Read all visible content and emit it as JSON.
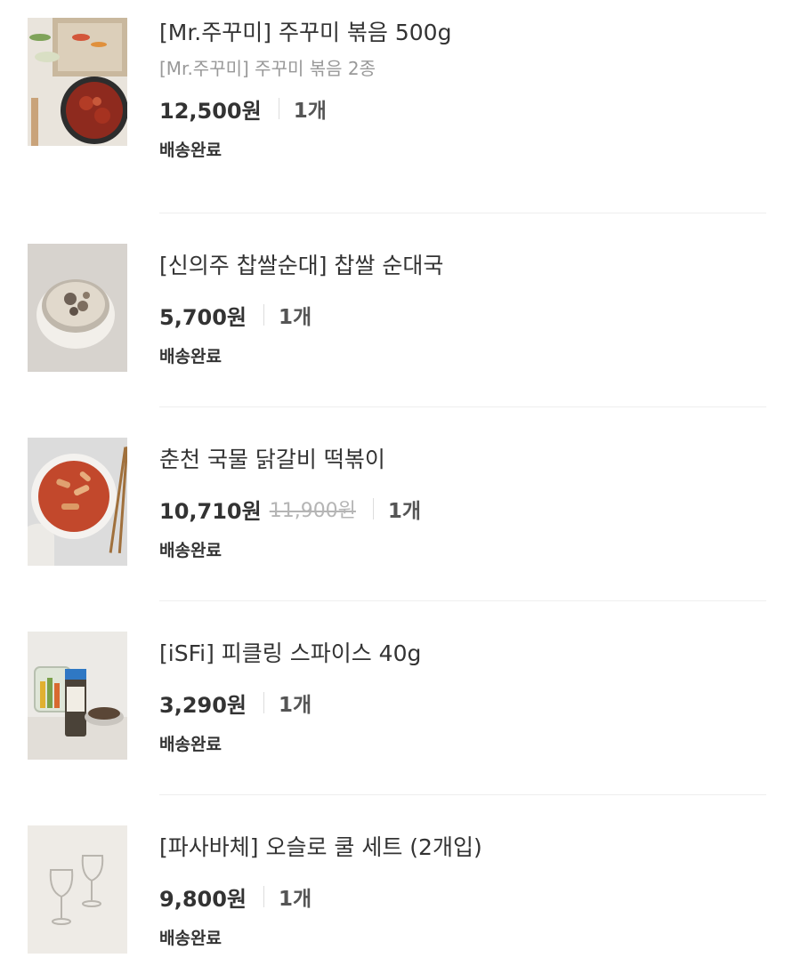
{
  "orders": [
    {
      "name": "[Mr.주꾸미] 주꾸미 볶음 500g",
      "option": "[Mr.주꾸미] 주꾸미 볶음 2종",
      "price": "12,500원",
      "original_price": null,
      "quantity": "1개",
      "status": "배송완료",
      "image": "stir-fried-webfoot-octopus-photo"
    },
    {
      "name": "[신의주 찹쌀순대] 찹쌀 순대국",
      "option": null,
      "price": "5,700원",
      "original_price": null,
      "quantity": "1개",
      "status": "배송완료",
      "image": "sundae-soup-bowl-photo"
    },
    {
      "name": "춘천 국물 닭갈비 떡볶이",
      "option": null,
      "price": "10,710원",
      "original_price": "11,900원",
      "quantity": "1개",
      "status": "배송완료",
      "image": "tteokbokki-plate-photo"
    },
    {
      "name": "[iSFi] 피클링 스파이스 40g",
      "option": null,
      "price": "3,290원",
      "original_price": null,
      "quantity": "1개",
      "status": "배송완료",
      "image": "pickling-spice-jar-photo"
    },
    {
      "name": "[파사바체] 오슬로 쿨 세트 (2개입)",
      "option": null,
      "price": "9,800원",
      "original_price": null,
      "quantity": "1개",
      "status": "배송완료",
      "image": "wine-glasses-photo"
    }
  ]
}
